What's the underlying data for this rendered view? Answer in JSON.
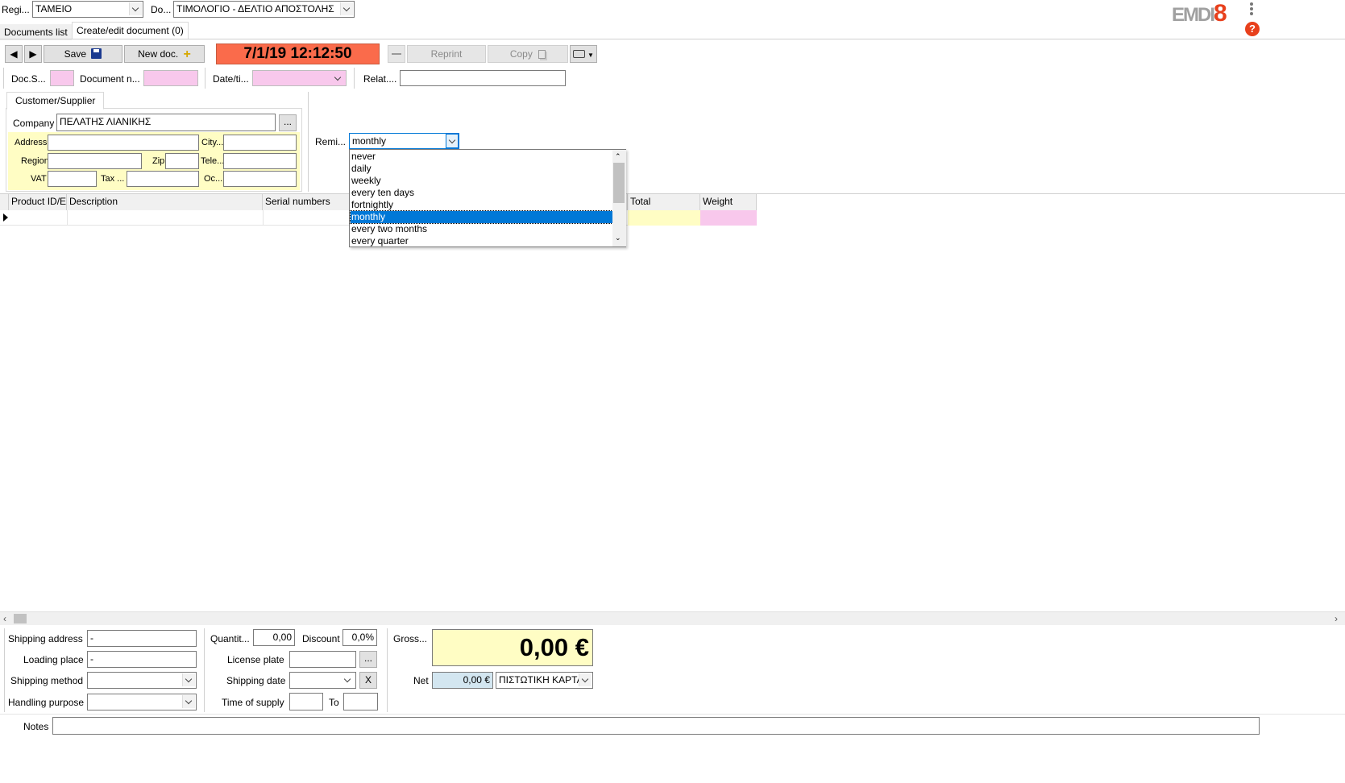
{
  "top": {
    "register_label": "Regi...",
    "register_value": "ΤΑΜΕΙΟ",
    "doc_label": "Do...",
    "doc_value": "ΤΙΜΟΛΟΓΙΟ - ΔΕΛΤΙΟ ΑΠΟΣΤΟΛΗΣ",
    "logo_text_1": "EMDI",
    "logo_text_2": "8",
    "help_glyph": "?"
  },
  "tabs": [
    "Documents list",
    "Create/edit document (0)"
  ],
  "toolbar": {
    "save_label": "Save",
    "new_doc_label": "New doc.",
    "datetime": "7/1/19 12:12:50",
    "reprint_label": "Reprint",
    "copy_label": "Copy"
  },
  "docrow": {
    "series_label": "Doc.S...",
    "number_label": "Document n...",
    "datetime_label": "Date/ti...",
    "related_label": "Relat...."
  },
  "customer": {
    "tab_label": "Customer/Supplier",
    "company_label": "Company",
    "company_value": "ΠΕΛΑΤΗΣ ΛΙΑΝΙΚΗΣ",
    "browse_label": "...",
    "address_label": "Address",
    "city_label": "City...",
    "region_label": "Region",
    "zip_label": "Zip",
    "tele_label": "Tele...",
    "vat_label": "VAT",
    "tax_label": "Tax ...",
    "oc_label": "Oc..."
  },
  "reminder": {
    "label": "Remi...",
    "selected": "monthly",
    "options": [
      "never",
      "daily",
      "weekly",
      "every ten days",
      "fortnightly",
      "monthly",
      "every two months",
      "every quarter"
    ]
  },
  "grid": {
    "columns": [
      "Product ID/E",
      "Description",
      "Serial numbers",
      "Total",
      "Weight"
    ]
  },
  "bottom": {
    "shipping_address_label": "Shipping address",
    "shipping_address_value": "-",
    "loading_place_label": "Loading place",
    "loading_place_value": "-",
    "shipping_method_label": "Shipping method",
    "handling_purpose_label": "Handling purpose",
    "quantity_label": "Quantit...",
    "quantity_value": "0,00",
    "discount_label": "Discount",
    "discount_value": "0,0%",
    "license_plate_label": "License plate",
    "license_browse": "...",
    "shipping_date_label": "Shipping date",
    "clear_label": "X",
    "time_of_supply_label": "Time of supply",
    "to_label": "To",
    "gross_label": "Gross...",
    "gross_value": "0,00 €",
    "net_label": "Net",
    "net_value": "0,00 €",
    "payment_value": "ΠΙΣΤΩΤΙΚΗ ΚΑΡΤΑ",
    "notes_label": "Notes"
  },
  "colors": {
    "accent_red": "#fa6b4b",
    "selection_blue": "#0078d7",
    "field_pink": "#f8c8ec",
    "field_yellow": "#fffdc4",
    "net_blue": "#d3e6f0"
  }
}
